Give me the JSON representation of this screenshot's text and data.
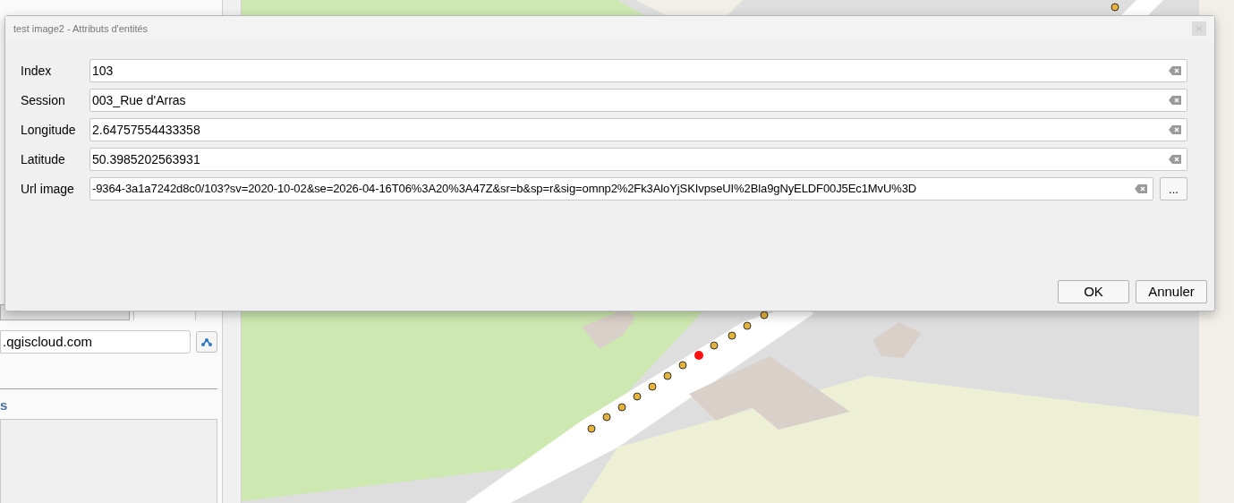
{
  "dialog": {
    "title": "test image2 - Attributs d'entités",
    "fields": [
      {
        "kind": "text",
        "label": "Index",
        "value": "103"
      },
      {
        "kind": "text",
        "label": "Session",
        "value": "003_Rue d'Arras"
      },
      {
        "kind": "text",
        "label": "Longitude",
        "value": "2.64757554433358"
      },
      {
        "kind": "text",
        "label": "Latitude",
        "value": "50.3985202563931"
      },
      {
        "kind": "url",
        "label": "Url image",
        "value": "-9364-3a1a7242d8c0/103?sv=2020-10-02&se=2026-04-16T06%3A20%3A47Z&sr=b&sp=r&sig=omnp2%2Fk3AloYjSKIvpseUI%2Bla9gNyELDF00J5Ec1MvU%3D",
        "browse": "..."
      }
    ],
    "buttons": [
      "OK",
      "Annuler"
    ]
  },
  "side_panel": {
    "server_field": ".qgiscloud.com",
    "heading": "s"
  }
}
